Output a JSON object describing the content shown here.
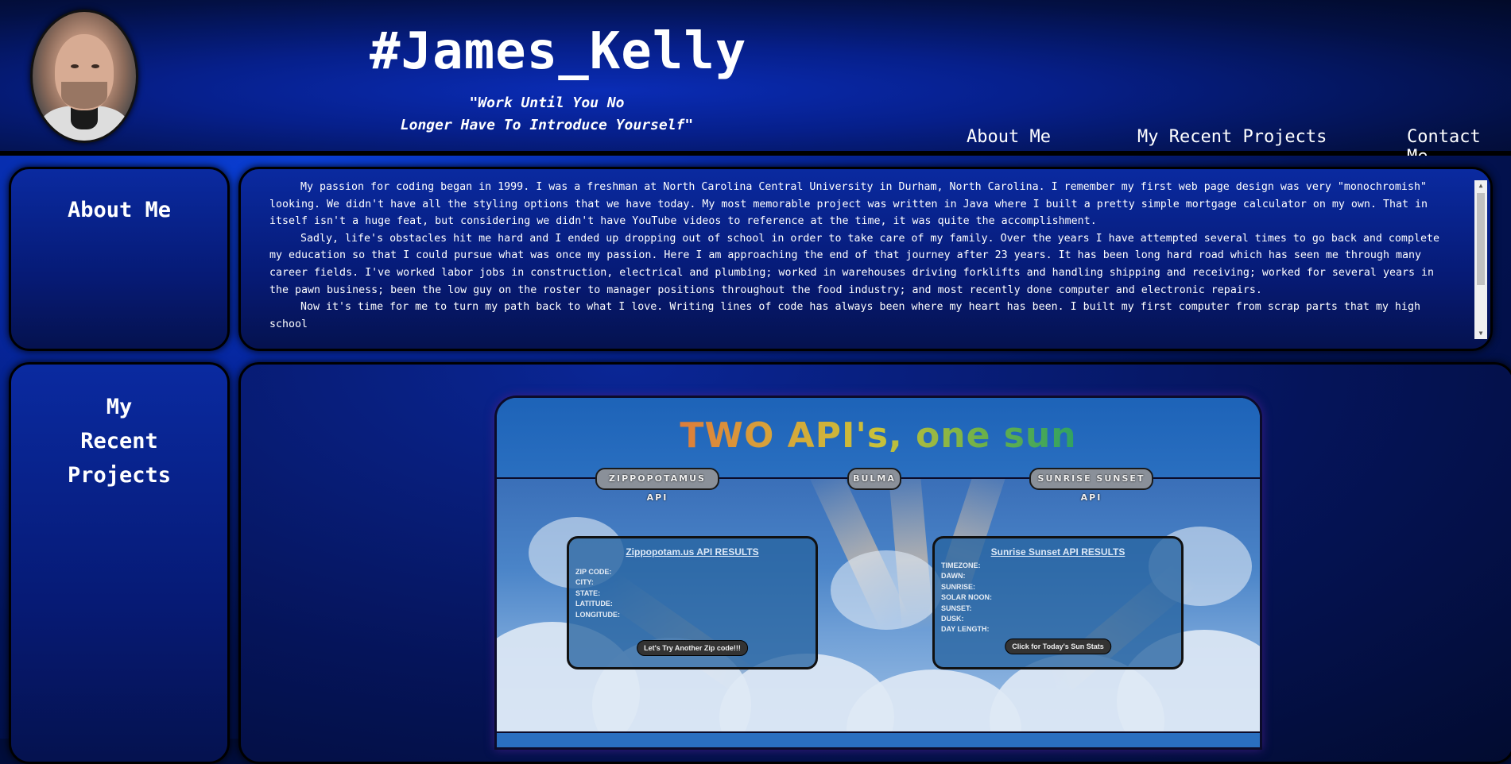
{
  "header": {
    "title": "#James_Kelly",
    "tagline_line1": "\"Work Until You No",
    "tagline_line2": "Longer Have To Introduce Yourself\"",
    "nav": [
      "About Me",
      "My Recent Projects",
      "Contact Me"
    ]
  },
  "about": {
    "heading": "About Me",
    "paragraphs": [
      "My passion for coding began in 1999. I was a freshman at North Carolina Central University in Durham, North Carolina. I remember my first web page design was very \"monochromish\" looking. We didn't have all the styling options that we have today. My most memorable project was written in Java where I built a pretty simple mortgage calculator on my own. That in itself isn't a huge feat, but considering we didn't have YouTube videos to reference at the time, it was quite the accomplishment.",
      "Sadly, life's obstacles hit me hard and I ended up dropping out of school in order to take care of my family. Over the years I have attempted several times to go back and complete my education so that I could pursue what was once my passion. Here I am approaching the end of that journey after 23 years. It has been long hard road which has seen me through many career fields. I've worked labor jobs in construction, electrical and plumbing; worked in warehouses driving forklifts and handling shipping and receiving; worked for several years in the pawn business; been the low guy on the roster to manager positions throughout the food industry; and most recently done computer and electronic repairs.",
      "Now it's time for me to turn my path back to what I love. Writing lines of code has always been where my heart has been. I built my first computer from scrap parts that my high school"
    ]
  },
  "projects": {
    "heading_line1": "My",
    "heading_line2": "Recent",
    "heading_line3": "Projects",
    "preview": {
      "title": "TWO API's, one sun",
      "tabs": [
        "ZIPPOPOTAMUS API",
        "BULMA",
        "SUNRISE SUNSET API"
      ],
      "zip_card": {
        "title": "Zippopotam.us API RESULTS",
        "fields": [
          "ZIP CODE:",
          "CITY:",
          "STATE:",
          "LATITUDE:",
          "LONGITUDE:"
        ],
        "button": "Let's Try Another Zip code!!!"
      },
      "sun_card": {
        "title": "Sunrise Sunset API RESULTS",
        "fields": [
          "TIMEZONE:",
          "DAWN:",
          "SUNRISE:",
          "SOLAR NOON:",
          "SUNSET:",
          "DUSK:",
          "DAY LENGTH:"
        ],
        "button": "Click for Today's Sun Stats"
      }
    }
  },
  "colors": {
    "header_bg": "#061f8a",
    "panel_bg": "#0a2aa0",
    "accent_purple": "#461e8c"
  }
}
